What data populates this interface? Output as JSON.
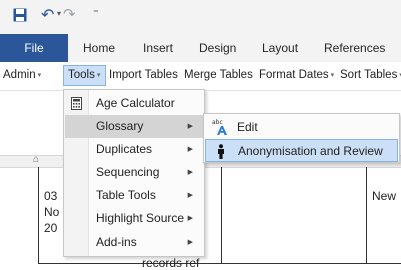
{
  "quick_access": {
    "save_icon": "save-icon",
    "undo_icon": "undo-icon",
    "redo_icon": "redo-icon",
    "undo_glyph": "↶",
    "dropdown_glyph": "▾",
    "redo_glyph": "↷",
    "customize_glyph": "⁼",
    "brand_color": "#2b579a"
  },
  "tabs": [
    {
      "label": "File"
    },
    {
      "label": "Home"
    },
    {
      "label": "Insert"
    },
    {
      "label": "Design"
    },
    {
      "label": "Layout"
    },
    {
      "label": "References"
    }
  ],
  "menubar": {
    "items": [
      {
        "label": "Admin",
        "has_dropdown": true
      },
      {
        "label": "Tools",
        "has_dropdown": true,
        "open": true
      },
      {
        "label": "Import Tables",
        "has_dropdown": false
      },
      {
        "label": "Merge Tables",
        "has_dropdown": false
      },
      {
        "label": "Format Dates",
        "has_dropdown": true
      },
      {
        "label": "Sort Tables",
        "has_dropdown": true
      }
    ],
    "dropdown_glyph": "▾"
  },
  "tools_menu": {
    "items": [
      {
        "label": "Age Calculator",
        "icon": "calculator-icon",
        "submenu": false
      },
      {
        "label": "Glossary",
        "submenu": true,
        "highlighted": true
      },
      {
        "label": "Duplicates",
        "submenu": true
      },
      {
        "label": "Sequencing",
        "submenu": true
      },
      {
        "label": "Table Tools",
        "submenu": true
      },
      {
        "label": "Highlight Source",
        "submenu": true
      },
      {
        "label": "Add-ins",
        "submenu": true
      }
    ],
    "submenu_glyph": "▶"
  },
  "glossary_submenu": {
    "items": [
      {
        "label": "Edit",
        "icon": "spell-check-icon"
      },
      {
        "label": "Anonymisation and Review",
        "icon": "person-icon",
        "highlighted": true
      }
    ]
  },
  "document": {
    "cell_lines": [
      "03",
      "No",
      "20"
    ],
    "right_text": "New",
    "bottom_text": "records ref"
  }
}
